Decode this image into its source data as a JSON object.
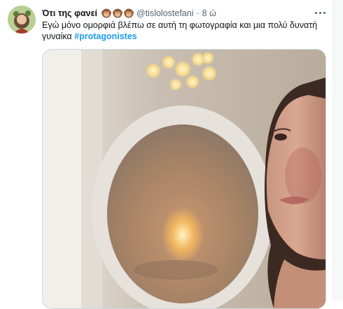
{
  "tweet": {
    "display_name": "Ότι της φανεί",
    "emoji_icons": [
      "see-no-evil-monkey-icon",
      "see-no-evil-monkey-icon",
      "see-no-evil-monkey-icon"
    ],
    "handle": "@tislolostefani",
    "separator": "·",
    "time": "8 ώ",
    "text_line1": "Εγώ μόνο ομορφιά βλέπω σε αυτή τη φωτογραφία και μια πολύ δυνατή",
    "text_line2": "γυναίκα ",
    "hashtag": "#protagonistes"
  },
  "colors": {
    "accent": "#1d9bf0",
    "text_primary": "#0f1419",
    "text_secondary": "#536471"
  }
}
